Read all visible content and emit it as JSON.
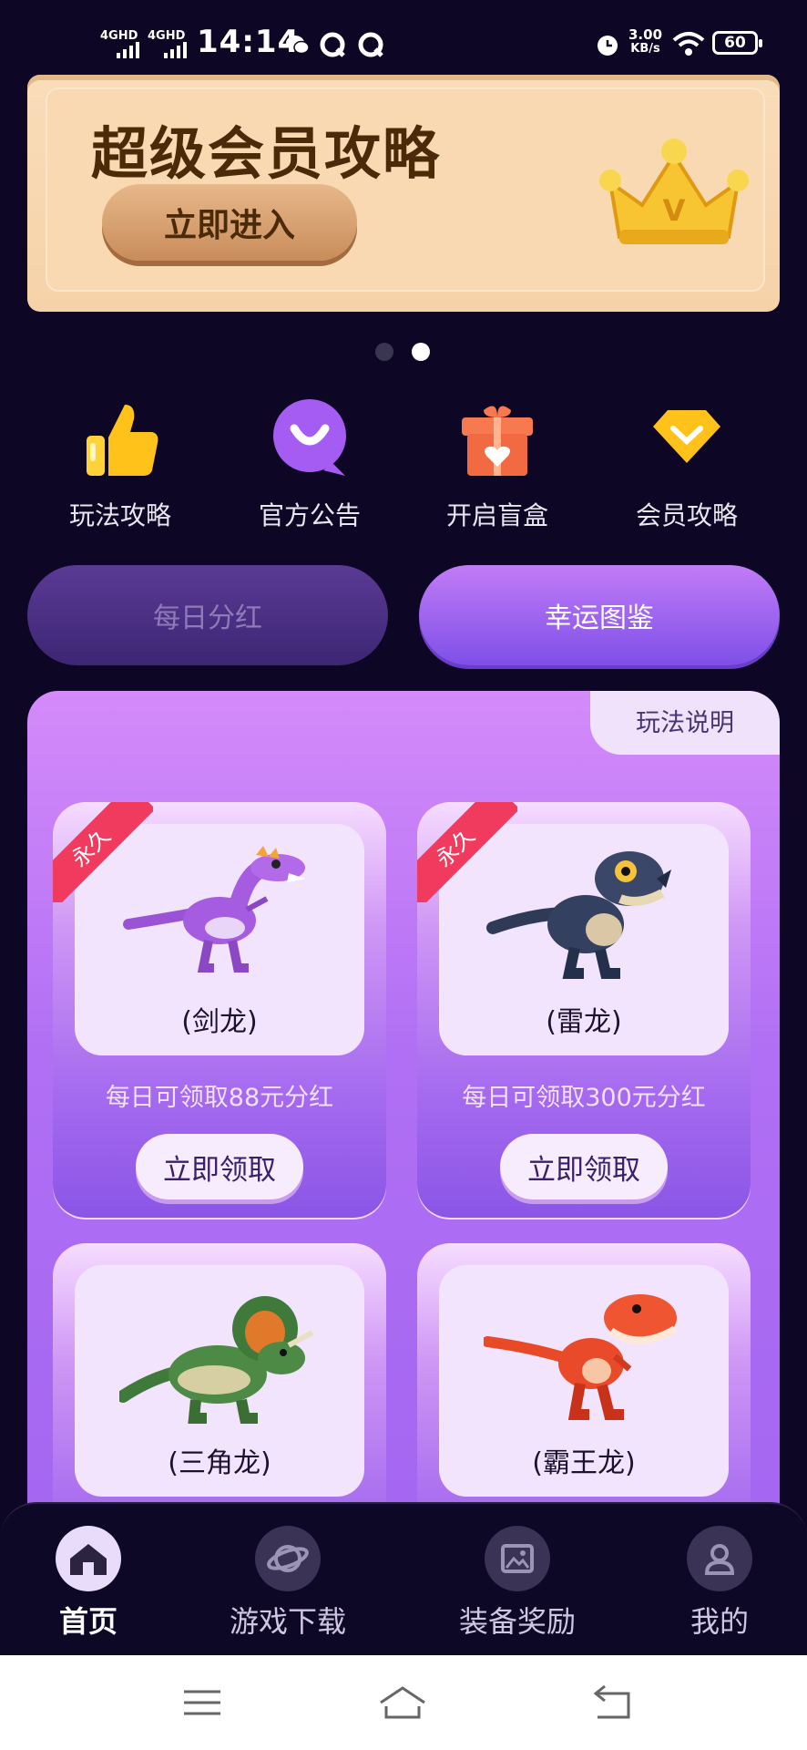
{
  "status_bar": {
    "sim1": "4GHD",
    "sim2": "4GHD",
    "time": "14:14",
    "speed_value": "3.00",
    "speed_unit": "KB/s",
    "battery": "60"
  },
  "banner": {
    "title": "超级会员攻略",
    "button_label": "立即进入",
    "crown_letter": "V"
  },
  "carousel": {
    "total": 2,
    "active_index": 1
  },
  "quick_menu": [
    {
      "label": "玩法攻略",
      "icon": "thumbs-up-icon"
    },
    {
      "label": "官方公告",
      "icon": "chat-bubble-icon"
    },
    {
      "label": "开启盲盒",
      "icon": "gift-box-icon"
    },
    {
      "label": "会员攻略",
      "icon": "diamond-icon"
    }
  ],
  "tabs": {
    "daily": "每日分红",
    "lucky": "幸运图鉴",
    "active": "lucky"
  },
  "panel": {
    "rules_label": "玩法说明"
  },
  "cards": [
    {
      "badge": "永久",
      "name": "(剑龙)",
      "reward": "每日可领取88元分红",
      "button": "立即领取"
    },
    {
      "badge": "永久",
      "name": "(雷龙)",
      "reward": "每日可领取300元分红",
      "button": "立即领取"
    },
    {
      "name": "(三角龙)"
    },
    {
      "name": "(霸王龙)"
    }
  ],
  "bottom_nav": [
    {
      "label": "首页",
      "icon": "home-icon",
      "active": true
    },
    {
      "label": "游戏下载",
      "icon": "planet-icon",
      "active": false
    },
    {
      "label": "装备奖励",
      "icon": "image-icon",
      "active": false
    },
    {
      "label": "我的",
      "icon": "user-icon",
      "active": false
    }
  ],
  "colors": {
    "background": "#0d0624",
    "accent_purple": "#b06ff4",
    "ribbon_red": "#f13b5e",
    "banner_gold": "#f8d9b2"
  }
}
